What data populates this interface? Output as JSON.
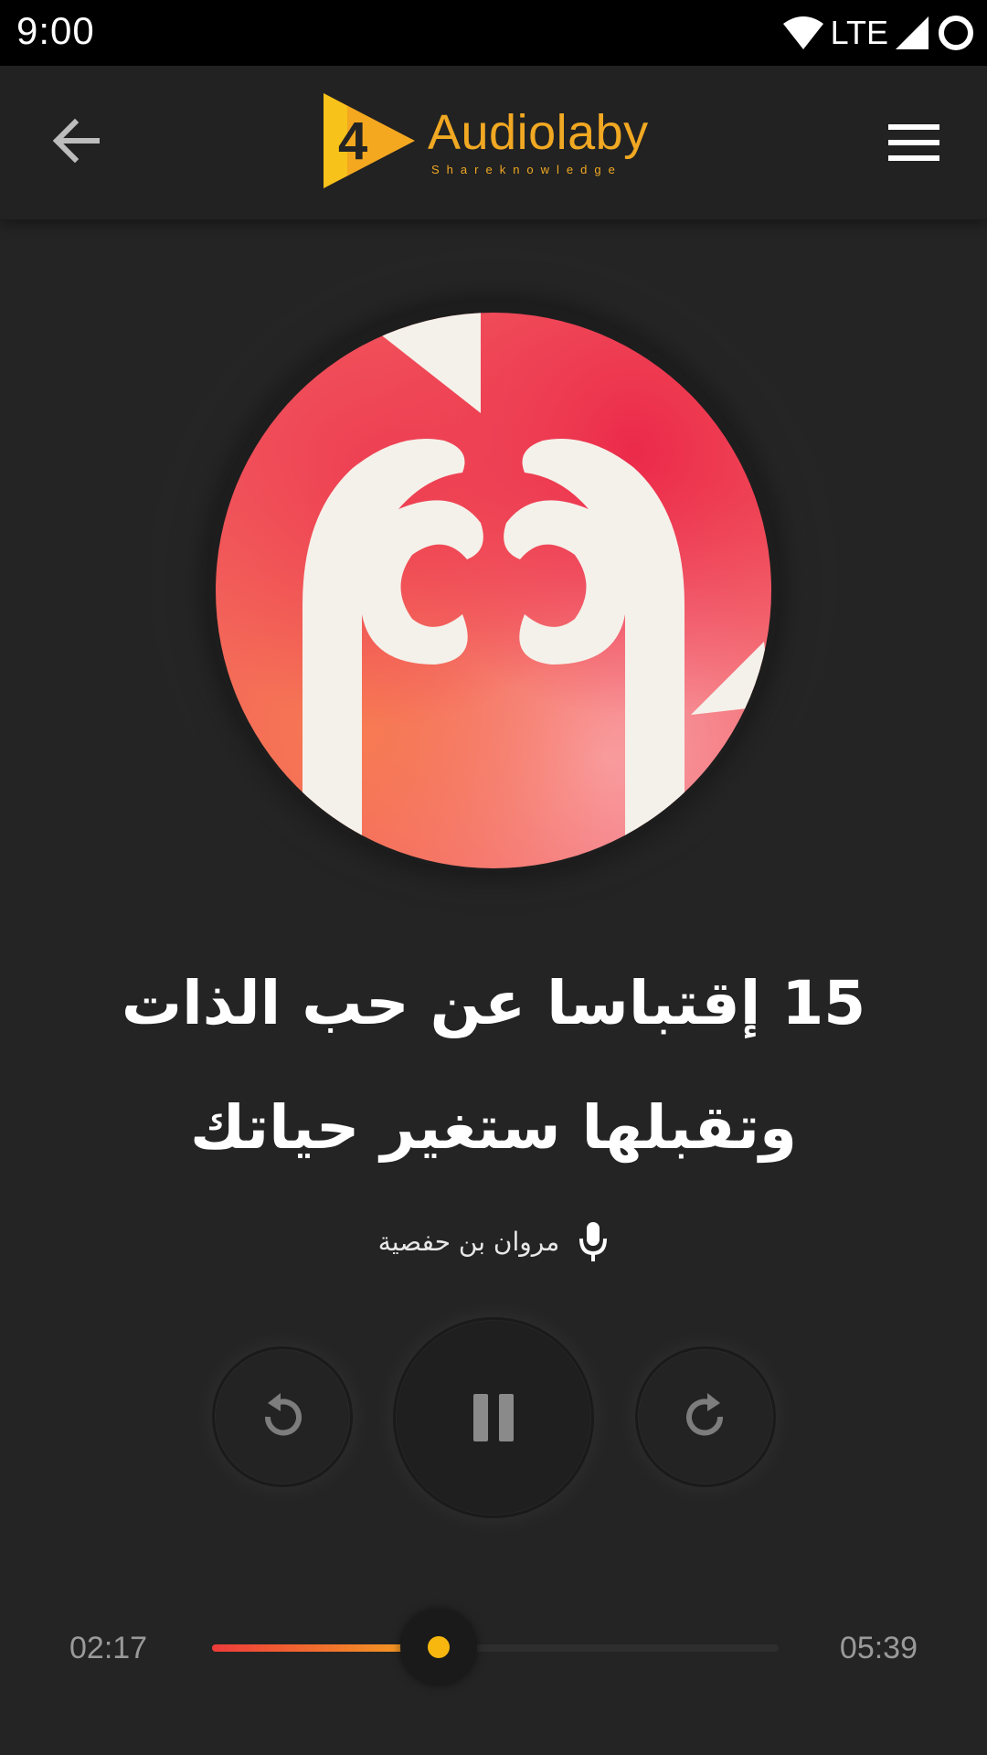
{
  "status_bar": {
    "time": "9:00",
    "network_label": "LTE",
    "icons": [
      "wifi-icon",
      "cell-signal-icon",
      "battery-icon"
    ]
  },
  "app_bar": {
    "back_icon": "arrow-left-icon",
    "menu_icon": "hamburger-menu-icon",
    "logo": {
      "name": "Audiolaby",
      "tagline": "Shareknowledge"
    }
  },
  "player": {
    "artwork": "heart-hands-icon",
    "title_line1": "15 إقتباسا عن حب الذات",
    "title_line2": "وتقبلها ستغير حياتك",
    "narrator_icon": "microphone-icon",
    "narrator": "مروان بن حفصية",
    "controls": {
      "rewind_icon": "rewind-icon",
      "pause_icon": "pause-icon",
      "forward_icon": "forward-icon"
    },
    "progress": {
      "elapsed": "02:17",
      "total": "05:39",
      "fraction": 0.4
    }
  },
  "colors": {
    "accent": "#f7b70f",
    "progress_start": "#ee3b3b",
    "progress_end": "#f4a81f",
    "background": "#242424",
    "logo": "#f1a822"
  }
}
